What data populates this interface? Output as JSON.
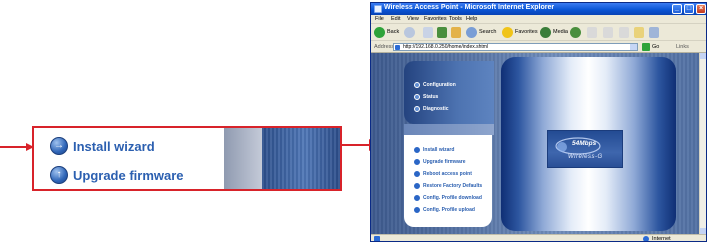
{
  "zoom": {
    "items": [
      {
        "label": "Install wizard",
        "icon": "arrow-icon"
      },
      {
        "label": "Upgrade firmware",
        "icon": "up-arrow-icon"
      }
    ],
    "accent_color": "#d8232a"
  },
  "browser": {
    "title": "Wireless Access Point - Microsoft Internet Explorer",
    "window_buttons": [
      "_",
      "□",
      "×"
    ],
    "menu": [
      "File",
      "Edit",
      "View",
      "Favorites",
      "Tools",
      "Help"
    ],
    "toolbar": {
      "back_label": "Back",
      "search_label": "Search",
      "favorites_label": "Favorites",
      "media_label": "Media"
    },
    "address": {
      "label": "Address",
      "url": "http://192.168.0.250/home/index.shtml",
      "go_label": "Go",
      "links_label": "Links"
    },
    "status": {
      "zone": "Internet"
    }
  },
  "page": {
    "top_nav": [
      "Configuration",
      "Status",
      "Diagnostic"
    ],
    "bottom_nav": [
      "Install wizard",
      "Upgrade firmware",
      "Reboot access point",
      "Restore Factory Defaults",
      "Config. Profile download",
      "Config. Profile upload"
    ],
    "logo": {
      "speed": "54Mbps",
      "brand": "Wireless-G"
    }
  }
}
